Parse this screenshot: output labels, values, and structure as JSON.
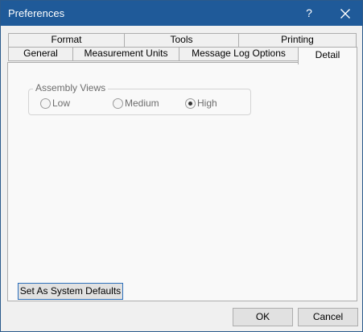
{
  "window": {
    "title": "Preferences",
    "help_glyph": "?"
  },
  "tabs": {
    "row1": [
      {
        "label": "Format"
      },
      {
        "label": "Tools"
      },
      {
        "label": "Printing"
      }
    ],
    "row2": [
      {
        "label": "General"
      },
      {
        "label": "Measurement Units"
      },
      {
        "label": "Message Log Options"
      },
      {
        "label": "Detail"
      }
    ],
    "selected": "Detail"
  },
  "detail": {
    "group_label": "Assembly Views",
    "options": [
      {
        "label": "Low"
      },
      {
        "label": "Medium"
      },
      {
        "label": "High"
      }
    ],
    "selected_option": "High"
  },
  "buttons": {
    "defaults": "Set As System Defaults",
    "ok": "OK",
    "cancel": "Cancel"
  },
  "icons": {
    "close": "close-icon",
    "radio": "radio-icon"
  },
  "colors": {
    "titlebar": "#1f5a99",
    "focus_border": "#2c6fbb"
  }
}
